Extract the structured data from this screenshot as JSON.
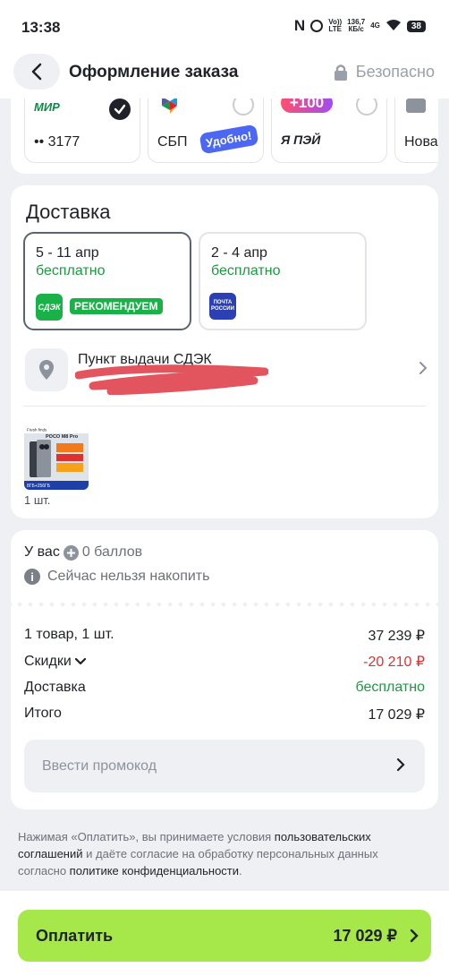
{
  "status_bar": {
    "time": "13:38",
    "n_label": "N",
    "network_top": "Vo))",
    "network_bottom": "LTE",
    "speed_value": "136,7",
    "speed_unit": "КБ/с",
    "signal": "4G",
    "battery": "38"
  },
  "header": {
    "title": "Оформление заказа",
    "secure_label": "Безопасно"
  },
  "payment_methods": [
    {
      "logo_text": "МИР",
      "label": "•• 3177",
      "selected": true
    },
    {
      "label": "СБП",
      "badge": "Удобно!",
      "selected": false
    },
    {
      "logo_text": "+100",
      "label": "Я ПЭЙ",
      "selected": false
    },
    {
      "label": "Нова"
    }
  ],
  "delivery": {
    "title": "Доставка",
    "options": [
      {
        "dates": "5 - 11 апр",
        "price": "бесплатно",
        "logo": "СДЭК",
        "badge": "РЕКОМЕНДУЕМ",
        "selected": true
      },
      {
        "dates": "2 - 4 апр",
        "price": "бесплатно",
        "logo": "ПОЧТА РОССИИ",
        "selected": false
      }
    ],
    "pickup_title": "Пункт выдачи СДЭК",
    "product": {
      "brand_tag": "Fresh finds",
      "model": "POCO M8 Pro",
      "memory": "8ГБ+256ГБ",
      "quantity": "1 шт."
    }
  },
  "points": {
    "prefix": "У вас",
    "balance": "0 баллов",
    "info": "Сейчас нельзя накопить"
  },
  "summary": {
    "items_label": "1 товар, 1 шт.",
    "items_value": "37 239 ₽",
    "discounts_label": "Скидки",
    "discounts_value": "-20 210 ₽",
    "delivery_label": "Доставка",
    "delivery_value": "бесплатно",
    "total_label": "Итого",
    "total_value": "17 029 ₽",
    "promo_placeholder": "Ввести промокод"
  },
  "legal": {
    "part1": "Нажимая «Оплатить», вы принимаете условия ",
    "link1": "пользовательских соглашений",
    "part2": " и даёте согласие на обработку персональных данных согласно ",
    "link2": "политике конфиденциальности",
    "part3": "."
  },
  "pay_button": {
    "label": "Оплатить",
    "amount": "17 029 ₽"
  },
  "colors": {
    "accent_green": "#a6e84a",
    "free_green": "#1a9b3e",
    "discount_red": "#e03131",
    "cdek_green": "#1ab248",
    "pochta_blue": "#2c3fb3"
  }
}
